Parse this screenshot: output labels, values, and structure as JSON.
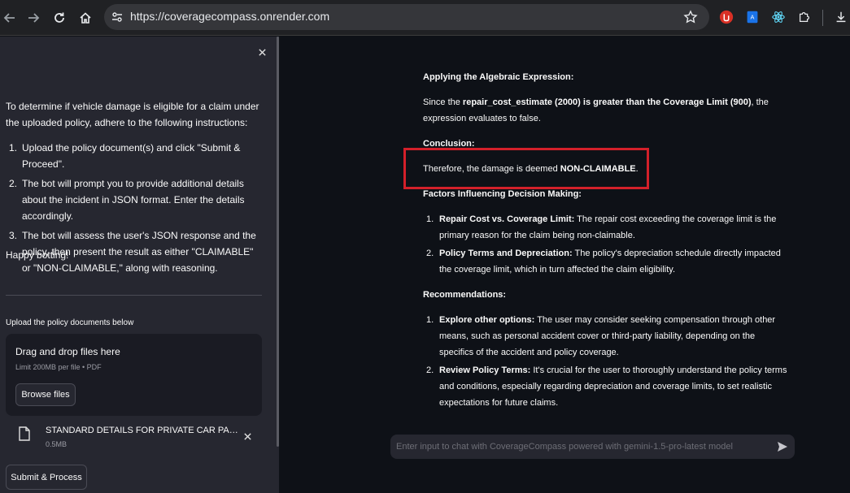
{
  "browser": {
    "url": "https://coveragecompass.onrender.com"
  },
  "sidebar": {
    "intro": "To determine if vehicle damage is eligible for a claim under the uploaded policy, adhere to the following instructions:",
    "steps": [
      {
        "num": "1.",
        "text": "Upload the policy document(s) and click \"Submit & Proceed\"."
      },
      {
        "num": "2.",
        "text": "The bot will prompt you to provide additional details about the incident in JSON format. Enter the details accordingly."
      },
      {
        "num": "3.",
        "text": "The bot will assess the user's JSON response and the policy, then present the result as either \"CLAIMABLE\" or \"NON-CLAIMABLE,\" along with reasoning."
      }
    ],
    "happy": "Happy botting!",
    "upload_label": "Upload the policy documents below",
    "dropzone": {
      "title": "Drag and drop files here",
      "limit": "Limit 200MB per file • PDF",
      "browse": "Browse files"
    },
    "file": {
      "name": "STANDARD DETAILS FOR PRIVATE CAR PACKAGE POLICY.pdf",
      "size": "0.5MB"
    },
    "submit": "Submit & Process"
  },
  "chat": {
    "heading_applying": "Applying the Algebraic Expression:",
    "since_pre": "Since the ",
    "since_bold": "repair_cost_estimate (2000) is greater than the Coverage Limit (900)",
    "since_post": ", the expression evaluates to false.",
    "heading_conclusion": "Conclusion:",
    "conclusion_pre": "Therefore, the damage is deemed ",
    "conclusion_bold": "NON-CLAIMABLE",
    "conclusion_post": ".",
    "heading_factors": "Factors Influencing Decision Making:",
    "factors": [
      {
        "num": "1.",
        "bold": "Repair Cost vs. Coverage Limit:",
        "text": " The repair cost exceeding the coverage limit is the primary reason for the claim being non-claimable."
      },
      {
        "num": "2.",
        "bold": "Policy Terms and Depreciation:",
        "text": " The policy's depreciation schedule directly impacted the coverage limit, which in turn affected the claim eligibility."
      }
    ],
    "heading_recs": "Recommendations:",
    "recs": [
      {
        "num": "1.",
        "bold": "Explore other options:",
        "text": " The user may consider seeking compensation through other means, such as personal accident cover or third-party liability, depending on the specifics of the accident and policy coverage."
      },
      {
        "num": "2.",
        "bold": "Review Policy Terms:",
        "text": " It's crucial for the user to thoroughly understand the policy terms and conditions, especially regarding depreciation and coverage limits, to set realistic expectations for future claims."
      }
    ],
    "input_placeholder": "Enter input to chat with CoverageCompass powered with gemini-1.5-pro-latest model"
  },
  "colors": {
    "sidebar_bg": "#262730",
    "main_bg": "#0e1117",
    "highlight": "#d3202a",
    "chrome_bg": "#202124"
  }
}
